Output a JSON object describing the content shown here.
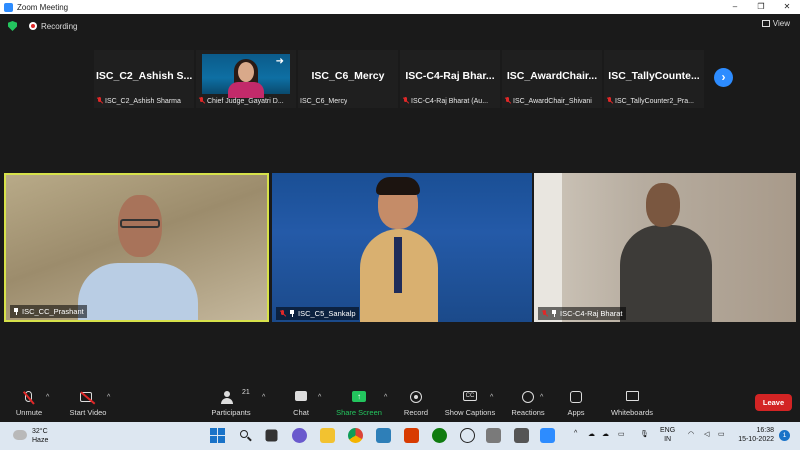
{
  "window": {
    "title": "Zoom Meeting",
    "controls": [
      "–",
      "❐",
      "✕"
    ]
  },
  "status": {
    "recording_label": "Recording",
    "view_label": "View"
  },
  "strip": {
    "tiles": [
      {
        "big": "ISC_C2_Ashish S...",
        "small": "ISC_C2_Ashish Sharma"
      },
      {
        "big": "",
        "small": "Chief Judge_Gayatri D..."
      },
      {
        "big": "ISC_C6_Mercy",
        "small": "ISC_C6_Mercy"
      },
      {
        "big": "ISC-C4-Raj Bhar...",
        "small": "ISC-C4-Raj Bharat (Au..."
      },
      {
        "big": "ISC_AwardChair...",
        "small": "ISC_AwardChair_Shivani"
      },
      {
        "big": "ISC_TallyCounte...",
        "small": "ISC_TallyCounter2_Pra..."
      }
    ],
    "next_icon": "chevron-right-icon"
  },
  "videos": [
    {
      "name": "ISC_CC_Prashant"
    },
    {
      "name": "ISC_C5_Sankalp"
    },
    {
      "name": "ISC-C4-Raj Bharat"
    }
  ],
  "toolbar": {
    "unmute": "Unmute",
    "start_video": "Start Video",
    "participants": "Participants",
    "participants_count": "21",
    "chat": "Chat",
    "share_screen": "Share Screen",
    "record": "Record",
    "show_captions": "Show Captions",
    "reactions": "Reactions",
    "apps": "Apps",
    "whiteboards": "Whiteboards",
    "leave": "Leave",
    "captions_icon_text": "CC"
  },
  "taskbar": {
    "temperature": "32°C",
    "weather": "Haze",
    "lang1": "ENG",
    "lang2": "IN",
    "time": "16:38",
    "date": "15-10-2022",
    "notifications": "1"
  },
  "colors": {
    "accent": "#2d8cff",
    "share_green": "#23c55e",
    "leave_red": "#d32424",
    "active_speaker": "#d7e24a"
  }
}
